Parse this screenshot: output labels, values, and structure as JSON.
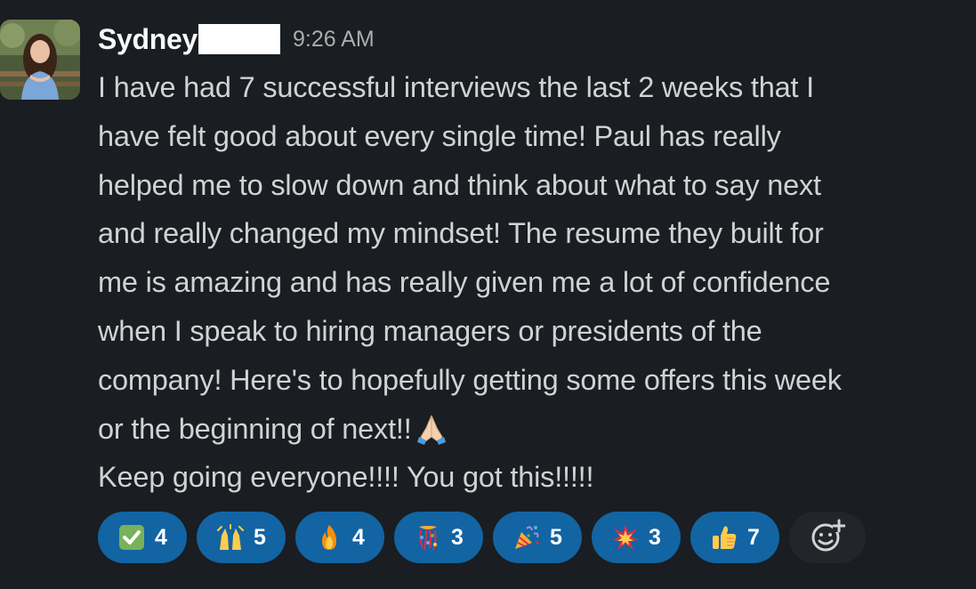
{
  "message": {
    "author": "Sydney",
    "author_redacted": true,
    "timestamp": "9:26 AM",
    "avatar": "user-photo-avatar",
    "lines": [
      "I have had 7 successful interviews the last 2 weeks that I",
      "have felt good about every single time! Paul has really",
      "helped me to slow down and think about what to say next",
      "and really changed my mindset! The resume they built for",
      "me is amazing and has really given me a lot of confidence",
      "when I speak to hiring managers or presidents of the",
      "company! Here's to hopefully getting some offers this week",
      "or the beginning of next!!",
      "Keep going everyone!!!! You got this!!!!!"
    ],
    "inline_emoji": "folded-hands-emoji"
  },
  "reactions": [
    {
      "emoji": "white-check-mark-emoji",
      "count": "4"
    },
    {
      "emoji": "raising-hands-emoji",
      "count": "5"
    },
    {
      "emoji": "fire-emoji",
      "count": "4"
    },
    {
      "emoji": "confetti-ball-emoji",
      "count": "3"
    },
    {
      "emoji": "party-popper-emoji",
      "count": "5"
    },
    {
      "emoji": "collision-emoji",
      "count": "3"
    },
    {
      "emoji": "thumbs-up-emoji",
      "count": "7"
    }
  ],
  "add_reaction": {
    "icon": "add-reaction-icon"
  },
  "colors": {
    "background": "#1a1d21",
    "reaction_background": "#1264a3",
    "text": "#d1d2d3"
  }
}
